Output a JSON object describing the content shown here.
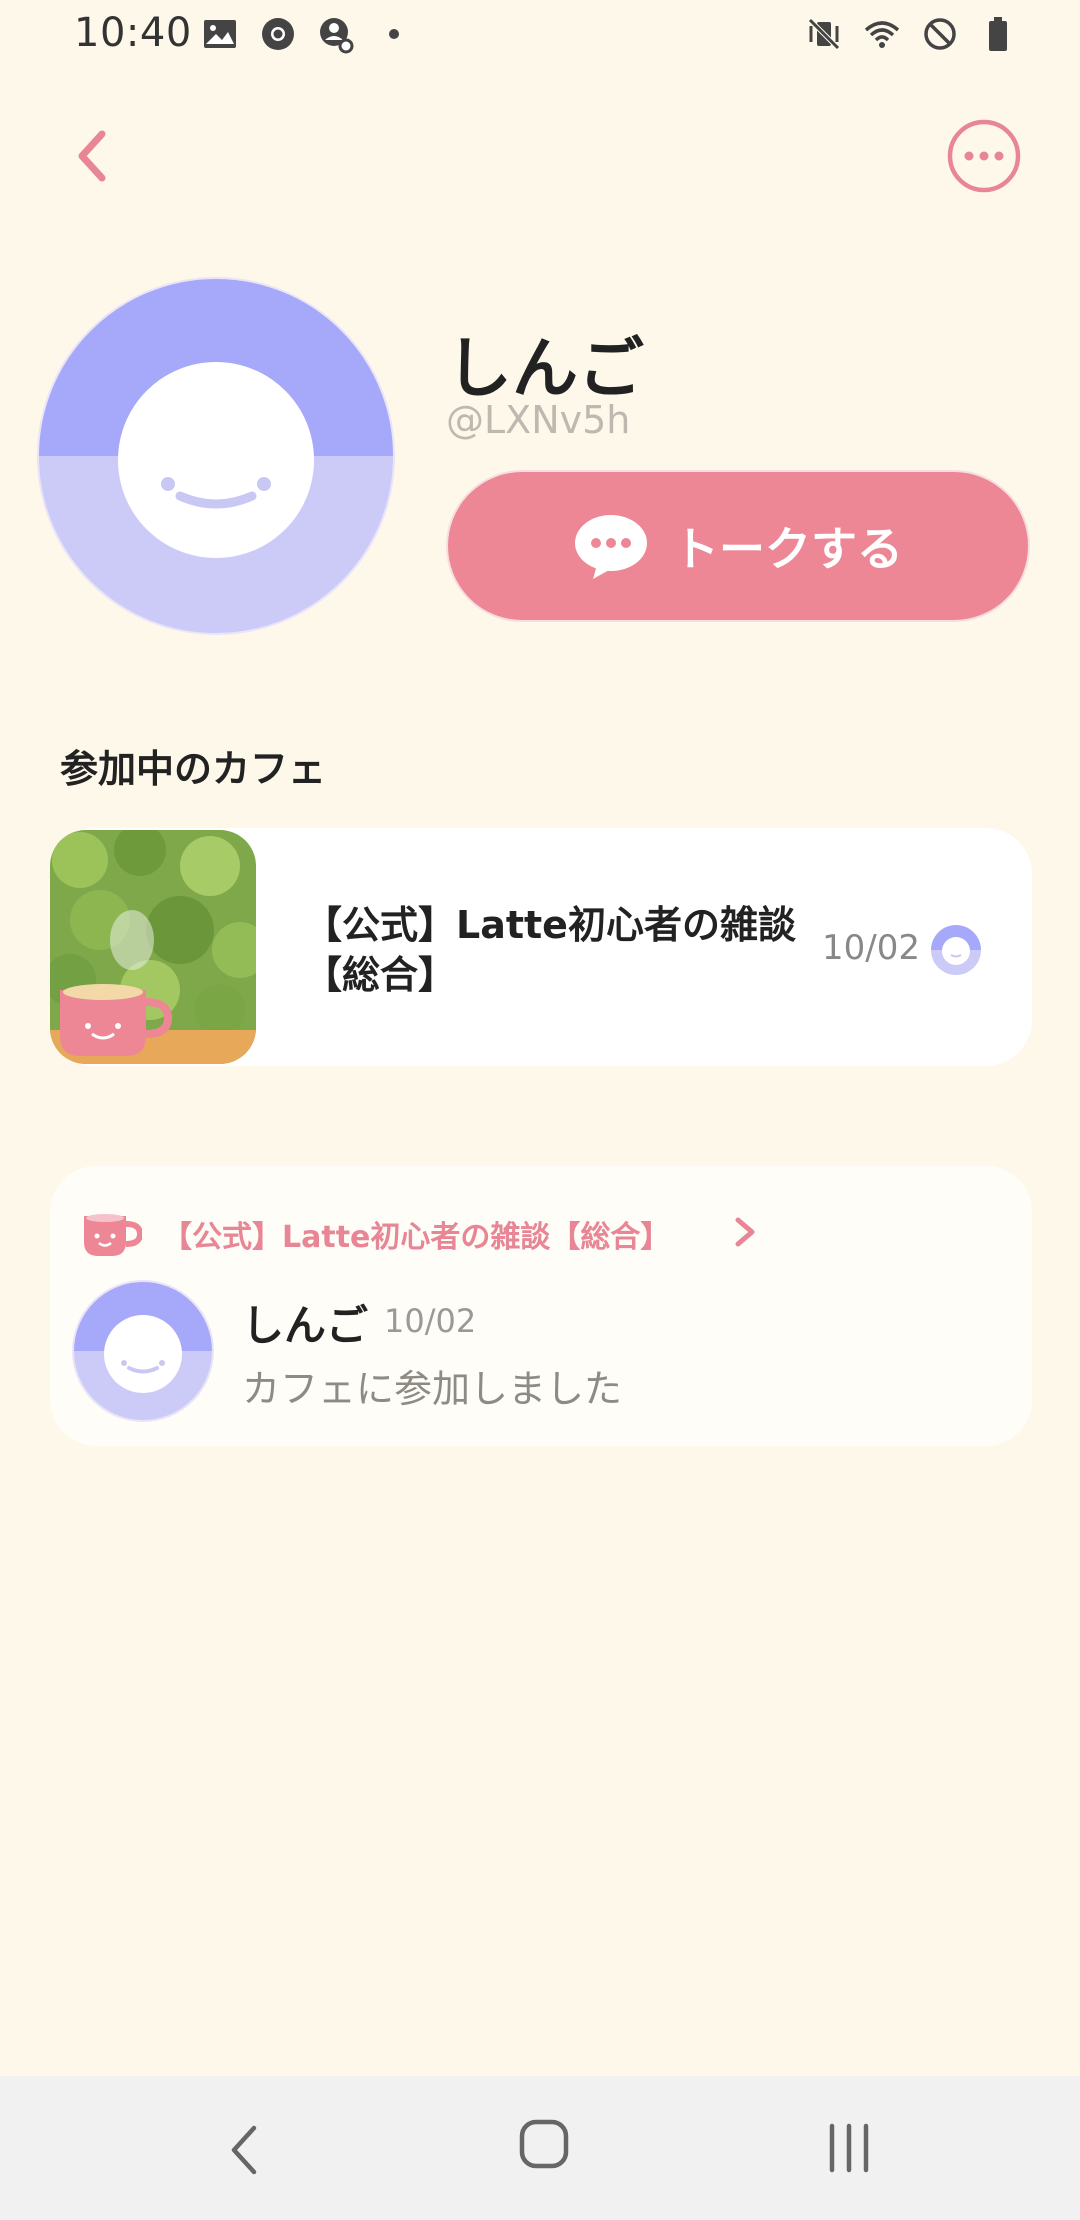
{
  "status_bar": {
    "time": "10:40",
    "left_icons": [
      "gallery-icon",
      "chrome-icon",
      "account-sync-icon",
      "notification-dot-icon"
    ],
    "right_icons": [
      "vibrate-mute-icon",
      "wifi-icon",
      "do-not-disturb-icon",
      "battery-icon"
    ]
  },
  "nav": {
    "back_icon": "chevron-left-icon",
    "more_icon": "more-horizontal-icon"
  },
  "profile": {
    "name": "しんご",
    "handle": "@LXNv5h",
    "talk_button_label": "トークする",
    "talk_icon": "speech-bubble-icon"
  },
  "cafes_section": {
    "title": "参加中のカフェ",
    "items": [
      {
        "name": "【公式】Latte初心者の雑談【総合】",
        "date": "10/02"
      }
    ]
  },
  "activity": {
    "cafe_link": "【公式】Latte初心者の雑談【総合】",
    "user_name": "しんご",
    "date": "10/02",
    "text": "カフェに参加しました"
  },
  "colors": {
    "background": "#FEF8EA",
    "accent_pink": "#EE8795",
    "avatar_top": "#A6A8FA",
    "avatar_bottom": "#CCCBF8"
  }
}
